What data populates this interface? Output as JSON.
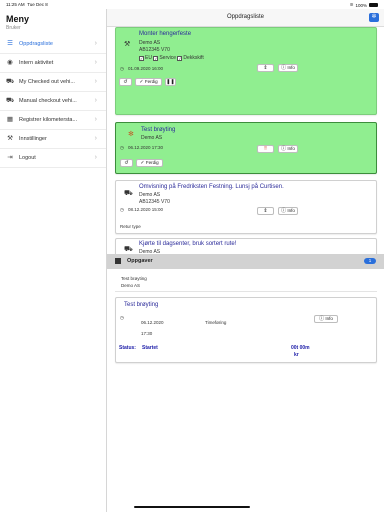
{
  "status_bar": {
    "time": "11:25 AM",
    "date": "Tue Dec 8",
    "battery": "100%"
  },
  "sidebar": {
    "title": "Meny",
    "subtitle": "Bruker",
    "items": [
      {
        "label": "Oppdragsliste",
        "icon": "list-icon",
        "active": true
      },
      {
        "label": "Intern aktivitet",
        "icon": "eye-icon",
        "active": false
      },
      {
        "label": "My Checked out vehi...",
        "icon": "car-icon",
        "active": false
      },
      {
        "label": "Manual checkout vehi...",
        "icon": "car-icon",
        "active": false
      },
      {
        "label": "Registrer kilometersta...",
        "icon": "calculator-icon",
        "active": false
      },
      {
        "label": "Innstillinger",
        "icon": "wrench-icon",
        "active": false
      },
      {
        "label": "Logout",
        "icon": "logout-icon",
        "active": false
      }
    ]
  },
  "navbar": {
    "title": "Oppdragsliste"
  },
  "cards": [
    {
      "title": "Monter hengerfeste",
      "customer": "Demo AS",
      "vehicle": "AB12345 V70",
      "checks": [
        "EU",
        "Service",
        "Dekkskift"
      ],
      "date": "01.09.2020 16:00",
      "info_label": "Info",
      "ferdig_label": "Ferdig"
    },
    {
      "title": "Test brøyting",
      "customer": "Demo AS",
      "date": "06.12.2020 17:30",
      "info_label": "Info",
      "ferdig_label": "Ferdig"
    },
    {
      "title": "Omvisning på Fredriksten Festning. Lunsj på Curtisen.",
      "customer": "Demo AS",
      "vehicle": "AB12345 V70",
      "date": "08.12.2020 15:00",
      "info_label": "Info",
      "retur_label": "Retur type"
    },
    {
      "title": "Kjørte til dagsenter, bruk sortert rute!",
      "customer": "Demo AS"
    }
  ],
  "tasks_section": {
    "title": "Oppgaver",
    "count": "1",
    "row": {
      "title": "Test brøyting",
      "customer": "Demo AS"
    },
    "card": {
      "title": "Test brøyting",
      "date": "06.12.2020",
      "time": "17:30",
      "type": "Timeføring",
      "info_label": "Info",
      "status_label": "Status:",
      "status_value": "Startet",
      "duration": "00t 00m",
      "unit": "kr"
    }
  }
}
